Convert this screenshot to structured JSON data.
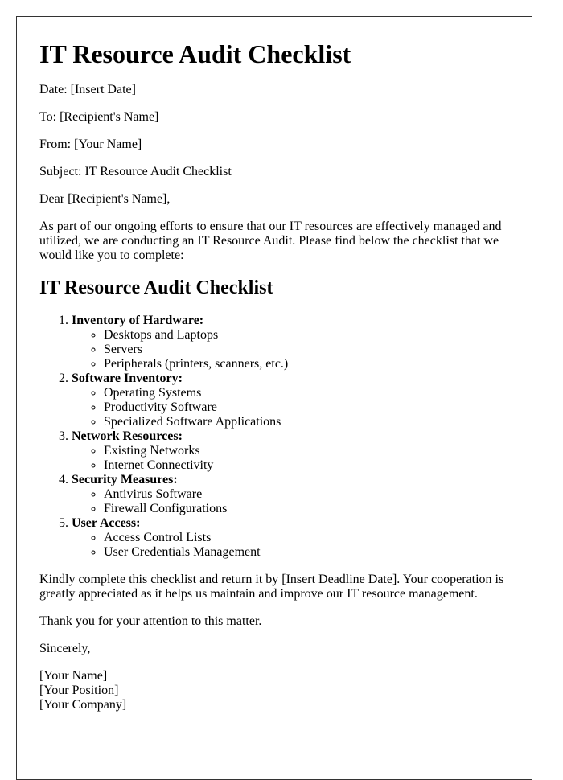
{
  "title": "IT Resource Audit Checklist",
  "header_fields": {
    "date": "Date: [Insert Date]",
    "to": "To: [Recipient's Name]",
    "from": "From: [Your Name]",
    "subject": "Subject: IT Resource Audit Checklist"
  },
  "salutation": "Dear [Recipient's Name],",
  "intro": "As part of our ongoing efforts to ensure that our IT resources are effectively managed and utilized, we are conducting an IT Resource Audit. Please find below the checklist that we would like you to complete:",
  "checklist": {
    "heading": "IT Resource Audit Checklist",
    "sections": [
      {
        "title": "Inventory of Hardware:",
        "items": [
          "Desktops and Laptops",
          "Servers",
          "Peripherals (printers, scanners, etc.)"
        ]
      },
      {
        "title": "Software Inventory:",
        "items": [
          "Operating Systems",
          "Productivity Software",
          "Specialized Software Applications"
        ]
      },
      {
        "title": "Network Resources:",
        "items": [
          "Existing Networks",
          "Internet Connectivity"
        ]
      },
      {
        "title": "Security Measures:",
        "items": [
          "Antivirus Software",
          "Firewall Configurations"
        ]
      },
      {
        "title": "User Access:",
        "items": [
          "Access Control Lists",
          "User Credentials Management"
        ]
      }
    ]
  },
  "closing_paragraph": "Kindly complete this checklist and return it by [Insert Deadline Date]. Your cooperation is greatly appreciated as it helps us maintain and improve our IT resource management.",
  "thanks": "Thank you for your attention to this matter.",
  "signoff": "Sincerely,",
  "signature": {
    "name": "[Your Name]",
    "position": "[Your Position]",
    "company": "[Your Company]"
  }
}
